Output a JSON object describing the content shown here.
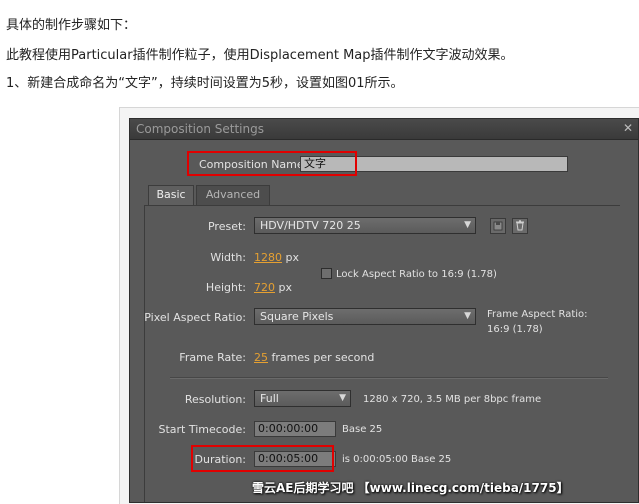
{
  "article": {
    "line1": "具体的制作步骤如下：",
    "line2": "此教程使用Particular插件制作粒子，使用Displacement Map插件制作文字波动效果。",
    "line3": "1、新建合成命名为“文字”，持续时间设置为5秒，设置如图01所示。"
  },
  "dialog": {
    "title": "Composition Settings",
    "close_symbol": "✕",
    "name_label": "Composition Name:",
    "name_value": "文字",
    "tabs": [
      {
        "label": "Basic",
        "active": true
      },
      {
        "label": "Advanced",
        "active": false
      }
    ],
    "preset": {
      "label": "Preset:",
      "value": "HDV/HDTV 720 25"
    },
    "width": {
      "label": "Width:",
      "value": "1280",
      "unit": "px"
    },
    "height": {
      "label": "Height:",
      "value": "720",
      "unit": "px"
    },
    "lock_aspect": {
      "label": "Lock Aspect Ratio to 16:9 (1.78)",
      "checked": false
    },
    "pixel_aspect": {
      "label": "Pixel Aspect Ratio:",
      "value": "Square Pixels"
    },
    "frame_aspect": {
      "label": "Frame Aspect Ratio:",
      "value": "16:9 (1.78)"
    },
    "frame_rate": {
      "label": "Frame Rate:",
      "value": "25",
      "unit": "frames per second"
    },
    "resolution": {
      "label": "Resolution:",
      "value": "Full",
      "info": "1280 x 720, 3.5 MB per 8bpc frame"
    },
    "start_timecode": {
      "label": "Start Timecode:",
      "value": "0:00:00:00",
      "info": "Base 25"
    },
    "duration": {
      "label": "Duration:",
      "value": "0:00:05:00",
      "info": "is 0:00:05:00  Base 25"
    }
  },
  "watermark": "雪云AE后期学习吧 【www.linecg.com/tieba/1775】",
  "colors": {
    "highlight": "#e10000",
    "value_accent": "#e5a032",
    "dialog_bg": "#595959"
  },
  "icons": {
    "dropdown": "chevron-down-icon",
    "save_preset": "save-icon",
    "delete_preset": "trash-icon"
  }
}
